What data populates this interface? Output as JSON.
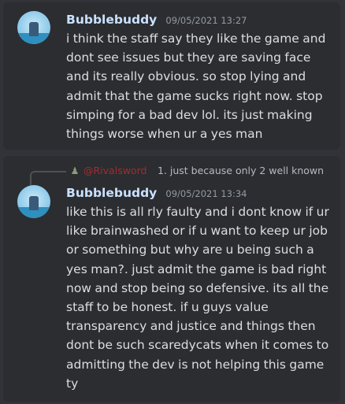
{
  "messages": [
    {
      "author": "Bubblebuddy",
      "timestamp": "09/05/2021 13:27",
      "lines": [
        "i think the staff say they like the game and",
        "dont see issues but they are saving face",
        "and its really obvious. so stop lying and",
        "admit that the game sucks right now. stop",
        "simping for a bad dev lol. its just making",
        "things worse when ur a yes man"
      ]
    },
    {
      "author": "Bubblebuddy",
      "timestamp": "09/05/2021 13:34",
      "reply": {
        "author": "@Rivalsword",
        "text": "1. just because only 2 well known"
      },
      "lines": [
        "like this is all rly faulty and i dont know if ur",
        "like brainwashed or if u want to keep ur job",
        "or something but why are u being such a",
        "yes man?. just admit the game is bad right",
        "now and stop being so defensive. its all the",
        "staff to be honest. if u guys value",
        "transparency and justice and things then",
        "dont be such scaredycats when it comes to",
        "admitting the dev is not helping this game",
        "ty"
      ]
    }
  ],
  "colors": {
    "background": "#313338",
    "card": "#2b2d31",
    "username": "#c9e1ff",
    "text": "#dbdee1",
    "timestamp": "#949ba4",
    "reply_author": "#a12d2d"
  },
  "icons": {
    "avatar": "avatar-image-icon",
    "reply_avatar": "reply-avatar-icon",
    "reply_connector": "reply-connector-icon"
  }
}
